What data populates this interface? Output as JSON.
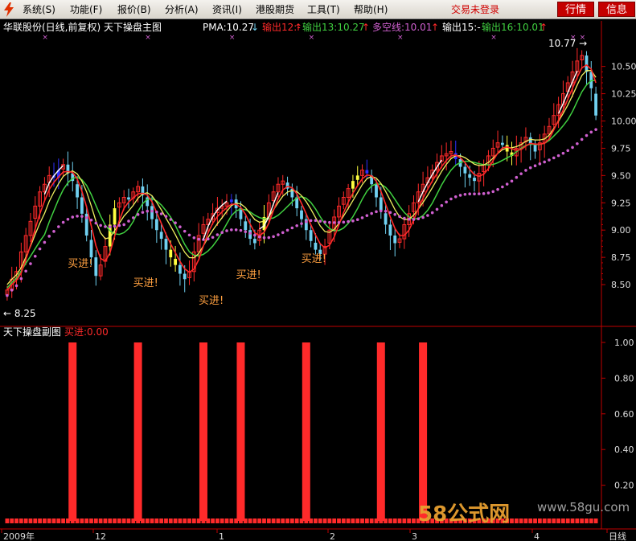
{
  "menu": {
    "items": [
      "系统(S)",
      "功能(F)",
      "报价(B)",
      "分析(A)",
      "资讯(I)",
      "港股期货",
      "工具(T)",
      "帮助(H)"
    ],
    "login_status": "交易未登录",
    "quote_btn": "行情",
    "info_btn": "信息"
  },
  "main_header": {
    "title": "华联股份(日线,前复权) 天下操盘主图",
    "pma": "PMA:10.27",
    "pma_arrow": "↓",
    "out12": "输出12:-",
    "out12_arrow": "↑",
    "out13": "输出13:10.27",
    "out13_arrow": "↑",
    "duokong": "多空线:10.01",
    "duokong_arrow": "↑",
    "out15": "输出15:-",
    "out16": "输出16:10.01",
    "out16_arrow": "↑"
  },
  "sub_header": {
    "title": "天下操盘副图",
    "buy_value": "买进:0.00"
  },
  "annotations": {
    "low_label": "← 8.25",
    "high_label": "10.77 →",
    "buy_label": "买进!"
  },
  "x_axis": {
    "labels": [
      "2009年",
      "12",
      "1",
      "2",
      "3",
      "4",
      "日线"
    ]
  },
  "watermark": {
    "brand": "58公式网",
    "url": "www.58gu.com"
  },
  "colors": {
    "up": "#ff2a2a",
    "down": "#70d0f0",
    "blue": "#3030ff",
    "yellow": "#ffff40",
    "green_line": "#40d040",
    "yellow_line": "#f0f060",
    "magenta_dots": "#d060d0",
    "white_line": "#ffffff",
    "red_line": "#ff2a2a",
    "axis": "#c00000",
    "buy_text": "#ffa040"
  },
  "chart_data": [
    {
      "type": "candlestick",
      "title": "华联股份(日线,前复权) 天下操盘主图",
      "ylim": [
        8.25,
        10.77
      ],
      "y_ticks": [
        8.5,
        8.75,
        9.0,
        9.25,
        9.5,
        9.75,
        10.0,
        10.25,
        10.5
      ],
      "low_marker": 8.25,
      "high_marker": 10.77,
      "closes": [
        8.45,
        8.55,
        8.62,
        8.8,
        8.95,
        9.08,
        9.22,
        9.35,
        9.42,
        9.5,
        9.48,
        9.55,
        9.6,
        9.52,
        9.45,
        9.3,
        9.15,
        8.95,
        8.75,
        8.58,
        8.68,
        8.85,
        9.05,
        9.2,
        9.25,
        9.3,
        9.28,
        9.35,
        9.4,
        9.32,
        9.22,
        9.1,
        9.0,
        8.92,
        8.82,
        8.75,
        8.68,
        8.6,
        8.55,
        8.62,
        8.8,
        8.95,
        9.05,
        9.1,
        9.15,
        9.2,
        9.22,
        9.25,
        9.28,
        9.2,
        9.1,
        9.0,
        8.92,
        8.88,
        9.0,
        9.12,
        9.25,
        9.35,
        9.42,
        9.45,
        9.38,
        9.3,
        9.2,
        9.1,
        9.0,
        8.9,
        8.82,
        8.78,
        8.85,
        9.0,
        9.12,
        9.22,
        9.3,
        9.38,
        9.45,
        9.5,
        9.55,
        9.52,
        9.42,
        9.3,
        9.18,
        9.05,
        8.95,
        8.88,
        8.92,
        9.05,
        9.15,
        9.25,
        9.35,
        9.42,
        9.48,
        9.55,
        9.62,
        9.68,
        9.7,
        9.72,
        9.65,
        9.58,
        9.52,
        9.48,
        9.45,
        9.52,
        9.6,
        9.68,
        9.75,
        9.8,
        9.78,
        9.72,
        9.68,
        9.75,
        9.8,
        9.85,
        9.78,
        9.72,
        9.8,
        9.88,
        9.95,
        10.05,
        10.15,
        10.25,
        10.35,
        10.45,
        10.55,
        10.6,
        10.45,
        10.3,
        10.05
      ],
      "series": [
        {
          "name": "PMA",
          "last": 10.27
        },
        {
          "name": "输出13",
          "last": 10.27
        },
        {
          "name": "多空线",
          "last": 10.01
        },
        {
          "name": "输出16",
          "last": 10.01
        }
      ]
    },
    {
      "type": "bar",
      "title": "天下操盘副图",
      "ylim": [
        0,
        1.0
      ],
      "y_ticks": [
        0.2,
        0.4,
        0.6,
        0.8,
        1.0
      ],
      "series": [
        {
          "name": "买进",
          "last": 0.0,
          "signal_bars": [
            14,
            28,
            42,
            50,
            64,
            80,
            89
          ]
        }
      ]
    }
  ]
}
